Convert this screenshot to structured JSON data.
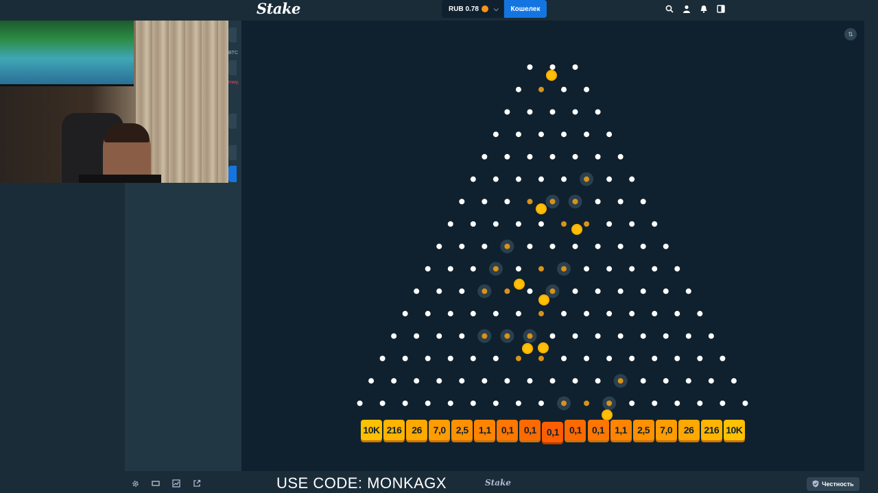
{
  "topbar": {
    "logo": "Stake",
    "balance_currency": "RUB",
    "balance_value": "0.78",
    "wallet_label": "Кошелек",
    "icons": [
      "search-icon",
      "user-icon",
      "bell-icon",
      "sidebar-toggle-icon"
    ]
  },
  "side_fragments": {
    "text_a": "BTC",
    "text_b": "mму,"
  },
  "game": {
    "rows": 16,
    "multipliers": [
      "10K",
      "216",
      "26",
      "7,0",
      "2,5",
      "1,1",
      "0,1",
      "0,1",
      "0,1",
      "0,1",
      "0,1",
      "1,1",
      "2,5",
      "7,0",
      "26",
      "216",
      "10K"
    ],
    "bucket_colors": [
      "#ffc000",
      "#ffb400",
      "#ffa800",
      "#ff9c00",
      "#ff9000",
      "#ff8400",
      "#ff7600",
      "#ff6a00",
      "#ff5e00",
      "#ff6a00",
      "#ff7600",
      "#ff8400",
      "#ff9000",
      "#ff9c00",
      "#ffa800",
      "#ffb400",
      "#ffc000"
    ],
    "active_bucket_index": 8,
    "colors": {
      "peg": "#ffffff",
      "ball": "#ffc107",
      "glow": "#2f4553",
      "hit": "#d9921a",
      "background": "#0f212e"
    }
  },
  "bottombar": {
    "icons": [
      "settings-icon",
      "theatre-mode-icon",
      "stats-icon",
      "popout-icon"
    ],
    "promo": "USE CODE: MONKAGX",
    "logo": "Stake",
    "fairness": "Честность"
  }
}
